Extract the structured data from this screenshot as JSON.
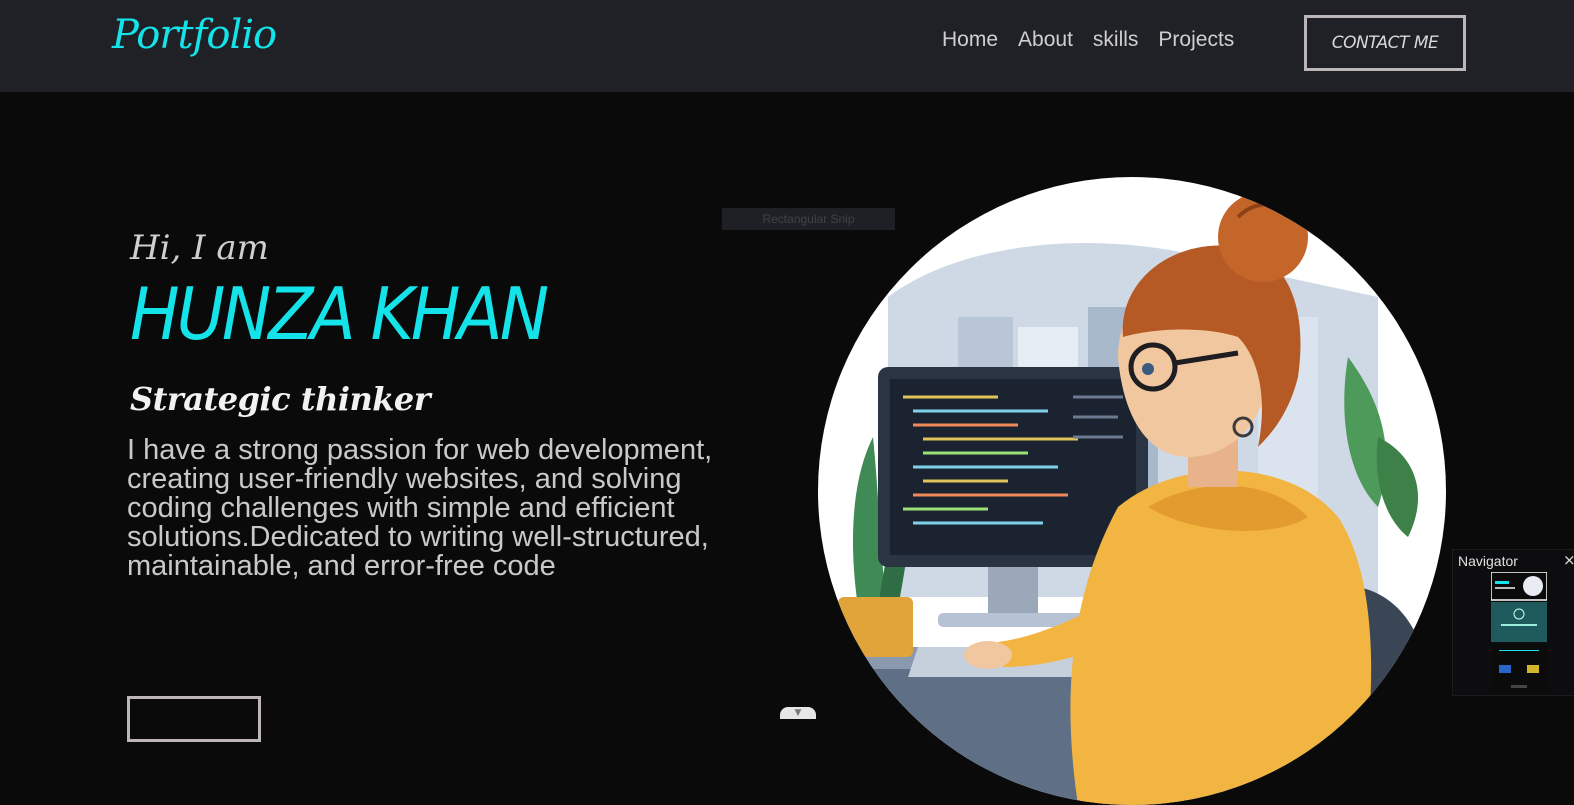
{
  "nav": {
    "logo": "Portfolio",
    "links": [
      "Home",
      "About",
      "skills",
      "Projects"
    ],
    "contact_label": "CONTACT ME"
  },
  "hero": {
    "greeting": "Hi, I am",
    "name": "HUNZA KHAN",
    "tagline": "Strategic thinker",
    "intro": "I have a strong passion for web development, creating user-friendly websites, and solving coding challenges with simple and efficient solutions.Dedicated to writing well-structured, maintainable, and error-free code"
  },
  "overlay": {
    "snip_label": "Rectangular Snip",
    "navigator_title": "Navigator",
    "close_icon": "×",
    "scroll_arrow": "▼"
  },
  "colors": {
    "accent": "#14e3ea",
    "nav_bg": "#1f2126",
    "page_bg": "#0a0a0b",
    "text": "#cfcfcf"
  },
  "icons": {
    "close": "close-icon",
    "scroll": "chevron-down-icon"
  },
  "illustration": {
    "subject": "woman-coding-at-computer-illustration"
  }
}
